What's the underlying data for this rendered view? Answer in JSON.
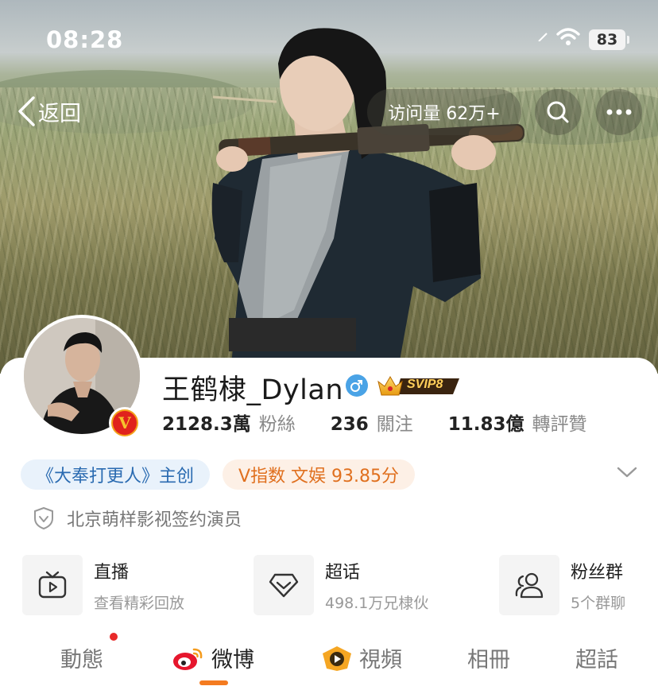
{
  "status_bar": {
    "time": "08:28",
    "battery": "83"
  },
  "header": {
    "back_label": "返回",
    "visits": "访问量 62万+"
  },
  "profile": {
    "name": "王鹤棣_Dylan",
    "svip": "SVIP8",
    "stats": [
      {
        "num": "2128.3萬",
        "label": "粉絲"
      },
      {
        "num": "236",
        "label": "關注"
      },
      {
        "num": "11.83億",
        "label": "轉評贊"
      }
    ],
    "tags": [
      "《大奉打更人》主创",
      "V指数 文娱 93.85分"
    ],
    "verification": "北京萌样影视签约演员"
  },
  "features": [
    {
      "title": "直播",
      "subtitle": "查看精彩回放",
      "icon": "tv-icon"
    },
    {
      "title": "超话",
      "subtitle": "498.1万兄棣伙",
      "icon": "diamond-icon"
    },
    {
      "title": "粉丝群",
      "subtitle": "5个群聊",
      "icon": "group-icon"
    }
  ],
  "tabs": [
    {
      "label": "動態"
    },
    {
      "label": "微博"
    },
    {
      "label": "視頻"
    },
    {
      "label": "相冊"
    },
    {
      "label": "超話"
    }
  ],
  "colors": {
    "accent": "#f47b20",
    "verified_blue": "#4aa3e6",
    "badge_red": "#e0221c"
  }
}
